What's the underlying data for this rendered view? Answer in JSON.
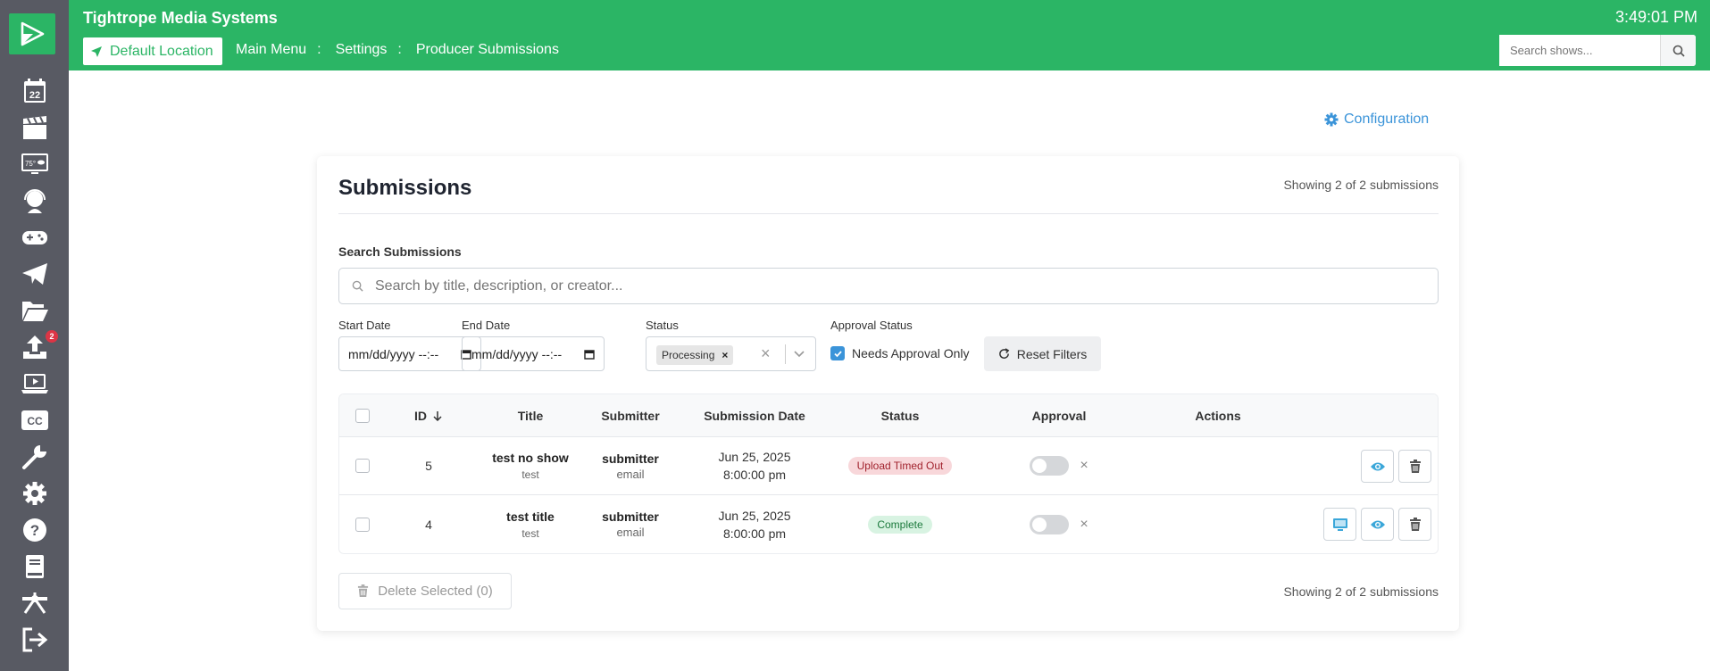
{
  "header": {
    "company": "Tightrope Media Systems",
    "clock": "3:49:01 PM",
    "location": "Default Location",
    "breadcrumbs": [
      "Main Menu",
      ":",
      "Settings",
      ":",
      "Producer Submissions"
    ],
    "search_placeholder": "Search shows..."
  },
  "sidebar": {
    "icons": [
      "calendar-icon",
      "clapperboard-icon",
      "monitor-weather-icon",
      "headset-icon",
      "gamepad-icon",
      "paper-plane-icon",
      "folder-open-icon",
      "upload-icon",
      "laptop-play-icon",
      "closed-caption-icon",
      "wrench-icon",
      "gear-icon",
      "help-icon",
      "book-icon",
      "network-icon",
      "logout-icon"
    ],
    "calendar_day": "22",
    "weather_temp": "75°",
    "upload_badge": "2",
    "cc_label": "CC"
  },
  "config_link": "Configuration",
  "card": {
    "title": "Submissions",
    "showing": "Showing 2 of 2 submissions",
    "search_label": "Search Submissions",
    "search_placeholder": "Search by title, description, or creator...",
    "filters": {
      "start_date_label": "Start Date",
      "start_date_value": "mm/dd/yyyy --:--",
      "end_date_label": "End Date",
      "end_date_value": "mm/dd/yyyy --:--",
      "status_label": "Status",
      "status_selected": "Processing",
      "approval_label": "Approval Status",
      "needs_approval": "Needs Approval Only",
      "reset": "Reset Filters"
    },
    "table": {
      "columns": [
        "ID",
        "Title",
        "Submitter",
        "Submission Date",
        "Status",
        "Approval",
        "Actions"
      ],
      "rows": [
        {
          "id": "5",
          "title": "test no show",
          "subtitle": "test",
          "submitter": "submitter",
          "submitter_sub": "email",
          "date": "Jun 25, 2025",
          "time": "8:00:00 pm",
          "status": "Upload Timed Out",
          "status_color": "#f8d7da"
        },
        {
          "id": "4",
          "title": "test title",
          "subtitle": "test",
          "submitter": "submitter",
          "submitter_sub": "email",
          "date": "Jun 25, 2025",
          "time": "8:00:00 pm",
          "status": "Complete",
          "status_color": "#d8f3e2"
        }
      ]
    },
    "delete_selected": "Delete Selected (0)"
  },
  "colors": {
    "brand": "#2bb565",
    "sidebar": "#585a63",
    "link": "#3b94d9"
  }
}
